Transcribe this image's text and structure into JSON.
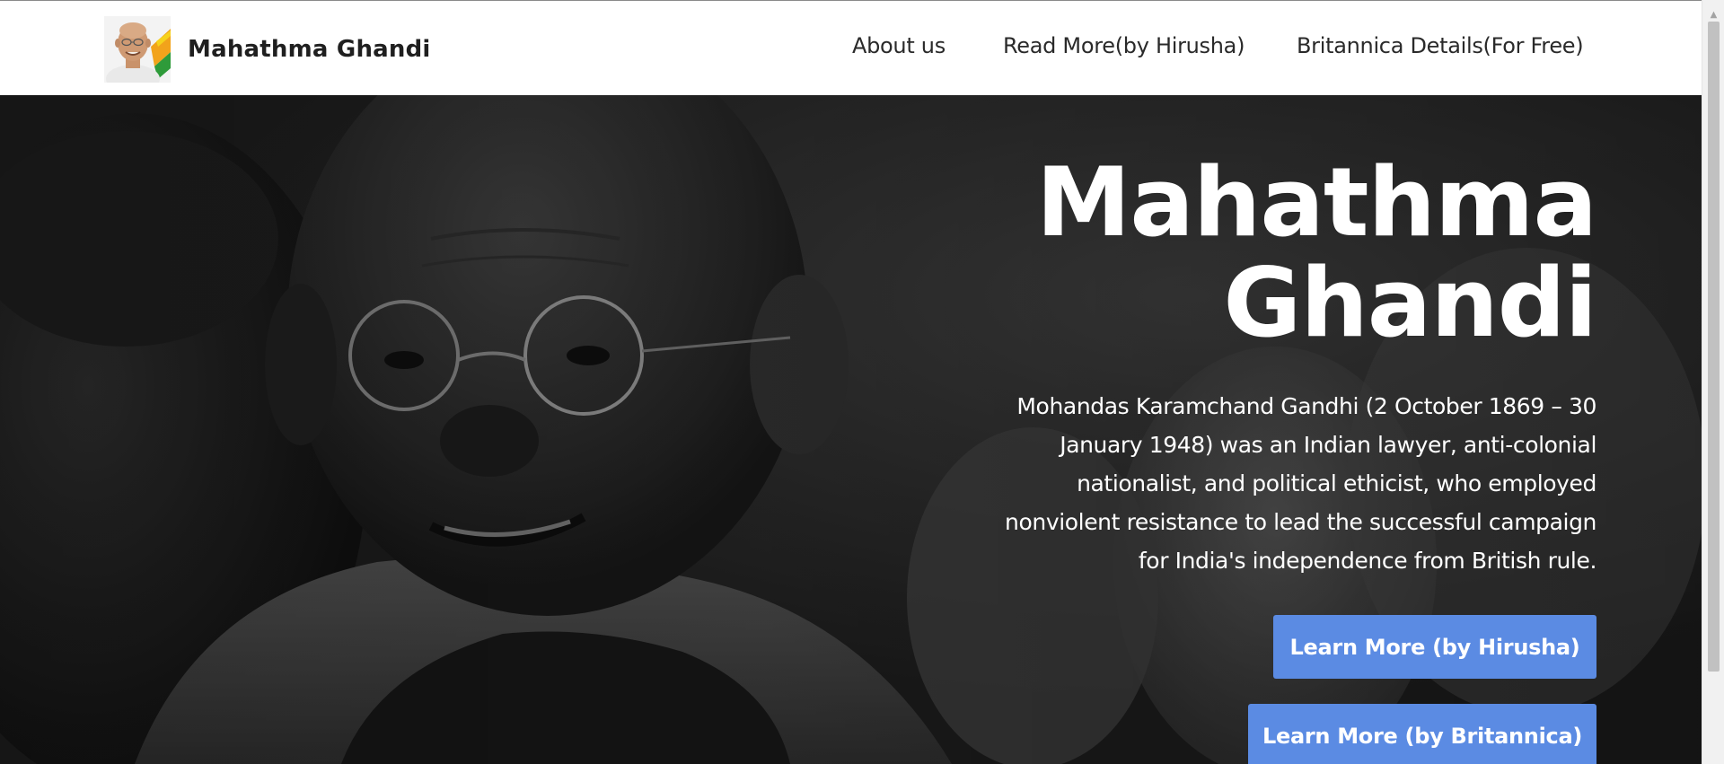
{
  "navbar": {
    "brand_name": "Mahathma Ghandi",
    "logo_icon": "gandhi-portrait-logo",
    "links": [
      {
        "label": "About us"
      },
      {
        "label": "Read More(by Hirusha)"
      },
      {
        "label": "Britannica Details(For Free)"
      }
    ]
  },
  "hero": {
    "title_line1": "Mahathma",
    "title_line2": "Ghandi",
    "description": "Mohandas Karamchand Gandhi (2 October 1869 – 30 January 1948) was an Indian lawyer, anti-colonial nationalist, and political ethicist, who employed nonviolent resistance to lead the successful campaign for India's independence from British rule.",
    "buttons": [
      {
        "label": "Learn More (by Hirusha)"
      },
      {
        "label": "Learn More (by Britannica)"
      }
    ]
  },
  "colors": {
    "accent_button": "#5b8be3",
    "navbar_bg": "#ffffff",
    "hero_text": "#ffffff"
  }
}
